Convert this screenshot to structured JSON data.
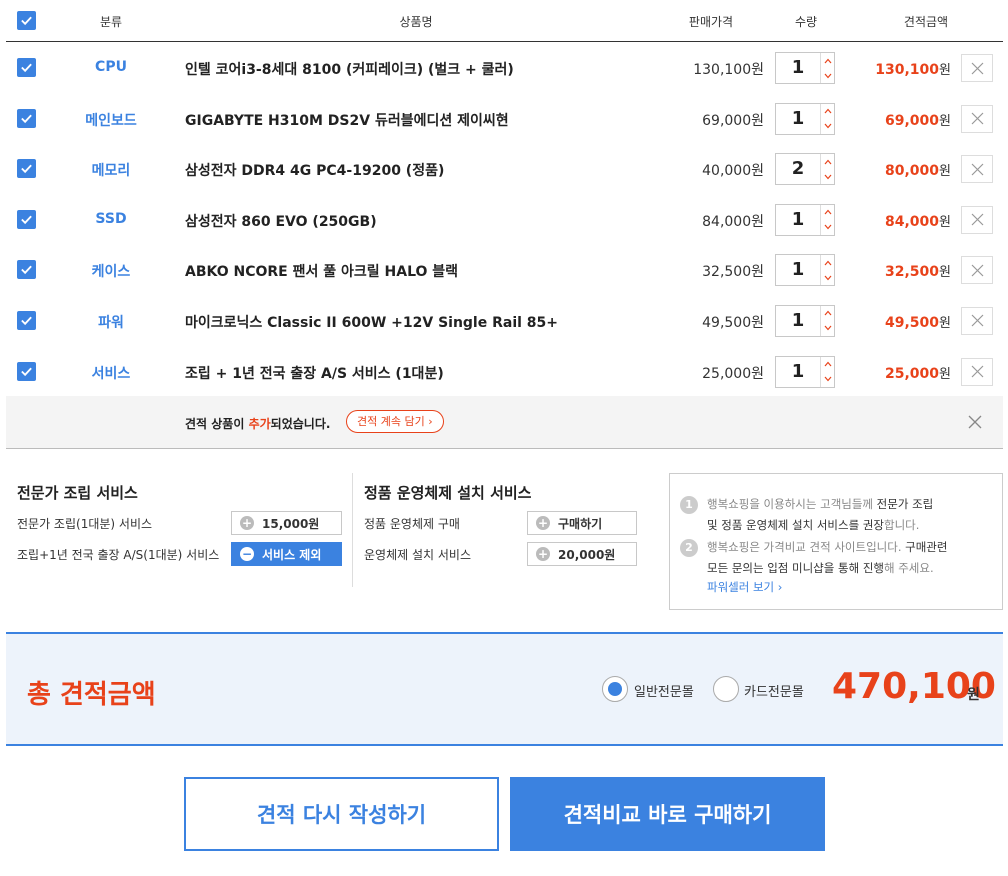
{
  "header": {
    "category": "분류",
    "product": "상품명",
    "price": "판매가격",
    "qty": "수량",
    "total": "견적금액"
  },
  "items": [
    {
      "category": "CPU",
      "name": "인텔 코어i3-8세대 8100 (커피레이크) (벌크 + 쿨러)",
      "price": "130,100원",
      "qty": "1",
      "total": "130,100",
      "won": "원"
    },
    {
      "category": "메인보드",
      "name": "GIGABYTE H310M DS2V 듀러블에디션 제이씨현",
      "price": "69,000원",
      "qty": "1",
      "total": "69,000",
      "won": "원"
    },
    {
      "category": "메모리",
      "name": "삼성전자 DDR4 4G PC4-19200 (정품)",
      "price": "40,000원",
      "qty": "2",
      "total": "80,000",
      "won": "원"
    },
    {
      "category": "SSD",
      "name": "삼성전자 860 EVO (250GB)",
      "price": "84,000원",
      "qty": "1",
      "total": "84,000",
      "won": "원"
    },
    {
      "category": "케이스",
      "name": "ABKO NCORE 팬서 풀 아크릴 HALO 블랙",
      "price": "32,500원",
      "qty": "1",
      "total": "32,500",
      "won": "원"
    },
    {
      "category": "파워",
      "name": "마이크로닉스 Classic II 600W +12V Single Rail 85+",
      "price": "49,500원",
      "qty": "1",
      "total": "49,500",
      "won": "원"
    },
    {
      "category": "서비스",
      "name": "조립 + 1년 전국 출장 A/S 서비스 (1대분)",
      "price": "25,000원",
      "qty": "1",
      "total": "25,000",
      "won": "원"
    }
  ],
  "notice": {
    "pre": "견적 상품이 ",
    "highlight": "추가",
    "post": "되었습니다.",
    "button": "견적 계속 담기 ›"
  },
  "assembly": {
    "title": "전문가 조립 서비스",
    "row1_label": "전문가 조립(1대분) 서비스",
    "row1_value": "15,000원",
    "row2_label": "조립+1년 전국 출장 A/S(1대분) 서비스",
    "row2_value": "서비스 제외"
  },
  "os": {
    "title": "정품 운영체제 설치 서비스",
    "row1_label": "정품 운영체제 구매",
    "row1_value": "구매하기",
    "row2_label": "운영체제 설치 서비스",
    "row2_value": "20,000원"
  },
  "info": {
    "n1": "1",
    "t1a": "행복쇼핑을 이용하시는 고객님들께 ",
    "t1b": "전문가 조립",
    "t1c": "및 정품 운영체제 설치 서비스를 권장",
    "t1d": "합니다.",
    "n2": "2",
    "t2a": "행복쇼핑은 가격비교 견적 사이트입니다. ",
    "t2b": "구매관련",
    "t2c": "모든 문의는 입점 미니샵을 통해 진행",
    "t2d": "해 주세요.",
    "link": "파워셀러 보기 ›"
  },
  "summary": {
    "label": "총 견적금액",
    "radio1": "일반전문몰",
    "radio2": "카드전문몰",
    "amount": "470,100",
    "won": "원"
  },
  "buttons": {
    "rewrite": "견적 다시 작성하기",
    "buy": "견적비교 바로 구매하기"
  },
  "colors": {
    "accent": "#3b82e0",
    "highlight": "#e8421a"
  }
}
